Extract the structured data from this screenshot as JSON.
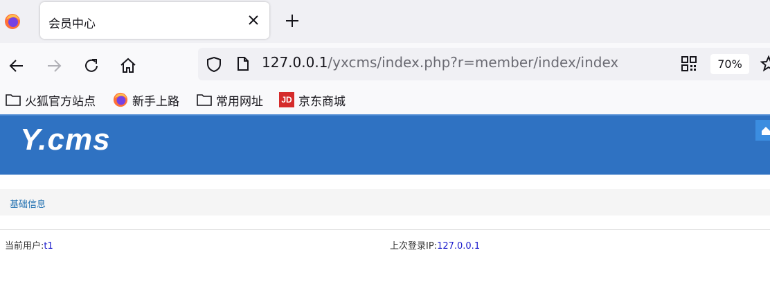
{
  "browser": {
    "tab": {
      "title": "会员中心"
    },
    "url": {
      "host": "127.0.0.1",
      "path": "/yxcms/index.php?r=member/index/index"
    },
    "zoom": "70%",
    "bookmarks": [
      {
        "label": "火狐官方站点",
        "icon": "folder-icon"
      },
      {
        "label": "新手上路",
        "icon": "firefox-icon"
      },
      {
        "label": "常用网址",
        "icon": "folder-icon"
      },
      {
        "label": "京东商城",
        "icon": "jd-icon",
        "badge": "JD"
      }
    ]
  },
  "page": {
    "logo": "Y.cms",
    "subnav": {
      "link": "基础信息"
    },
    "info": {
      "current_user_label": "当前用户:",
      "current_user_value": "t1",
      "last_login_label": "上次登录IP:",
      "last_login_value": "127.0.0.1"
    },
    "colors": {
      "header": "#2f72c2",
      "link": "#2271b1",
      "value": "#1a1acc"
    }
  }
}
